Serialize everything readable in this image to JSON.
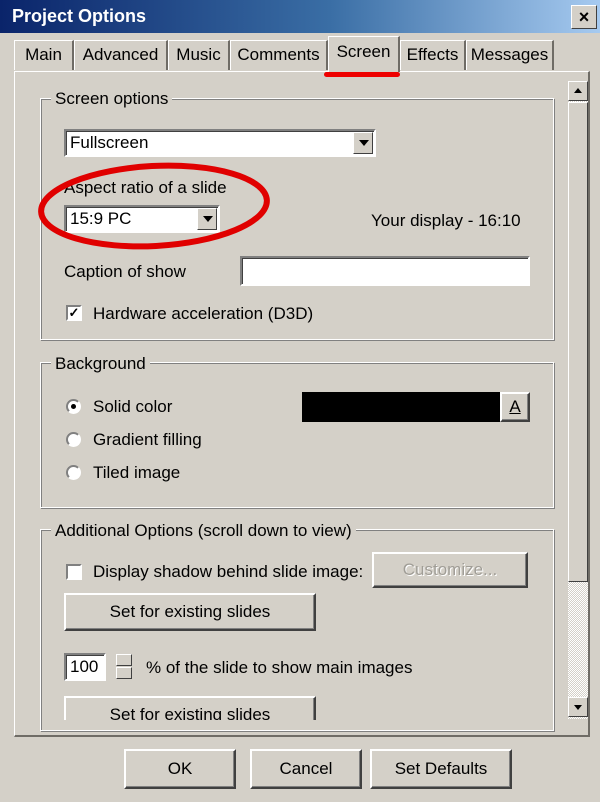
{
  "window": {
    "title": "Project Options",
    "close_glyph": "×"
  },
  "tabs": [
    {
      "label": "Main"
    },
    {
      "label": "Advanced"
    },
    {
      "label": "Music"
    },
    {
      "label": "Comments"
    },
    {
      "label": "Screen",
      "active": true
    },
    {
      "label": "Effects"
    },
    {
      "label": "Messages"
    }
  ],
  "screen_options": {
    "legend": "Screen options",
    "mode_value": "Fullscreen",
    "aspect_label": "Aspect ratio of a slide",
    "aspect_value": "15:9 PC",
    "display_info": "Your display - 16:10",
    "caption_label": "Caption of show",
    "caption_value": "",
    "hw_accel_label": "Hardware acceleration (D3D)",
    "hw_accel_checked": true
  },
  "background": {
    "legend": "Background",
    "options": [
      "Solid color",
      "Gradient filling",
      "Tiled image"
    ],
    "selected": "Solid color",
    "color": "#000000",
    "color_button_label": "A"
  },
  "additional": {
    "legend": "Additional Options (scroll down to view)",
    "shadow_label": "Display shadow behind slide image:",
    "shadow_checked": false,
    "customize_label": "Customize...",
    "set_existing_label": "Set for existing slides",
    "percent_value": "100",
    "percent_label": "% of the slide to show main images",
    "set_existing_label_2": "Set for existing slides"
  },
  "footer": {
    "ok_label": "OK",
    "cancel_label": "Cancel",
    "defaults_label": "Set Defaults"
  },
  "annotation_color": "#e00000",
  "icons": [
    "close-icon",
    "dropdown-arrow-icon",
    "checkmark-icon",
    "scroll-up-icon",
    "scroll-down-icon",
    "spin-up-icon",
    "spin-down-icon"
  ]
}
